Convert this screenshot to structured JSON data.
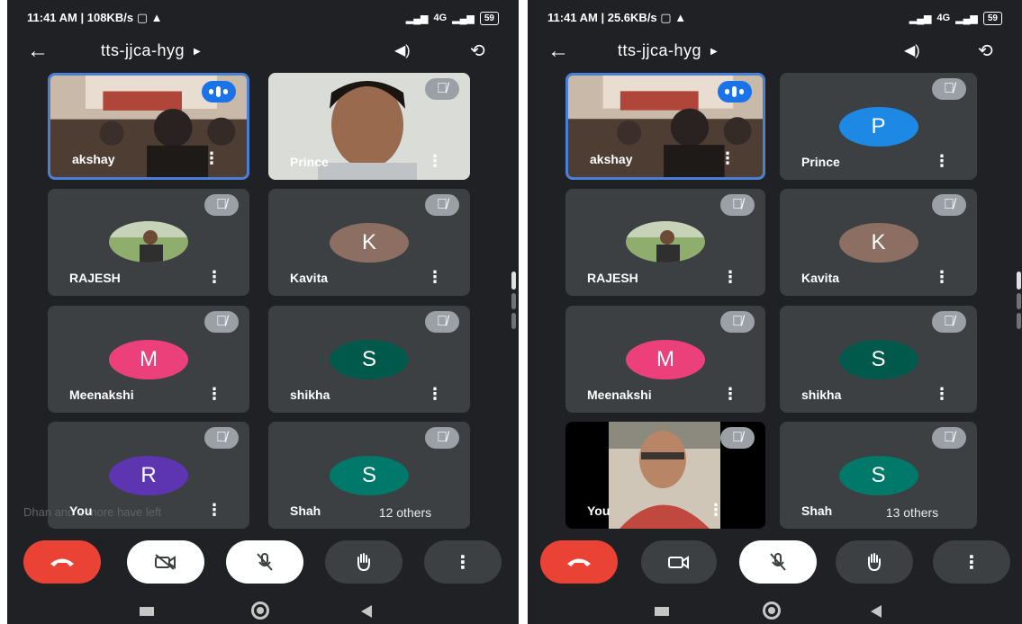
{
  "left": {
    "status": {
      "time": "11:41 AM | 108KB/s",
      "network": "4G",
      "battery": "59"
    },
    "meeting_title": "tts-jjca-hyg",
    "tiles": [
      {
        "name": "akshay",
        "initial": "",
        "color": "",
        "speaking": true
      },
      {
        "name": "Prince",
        "initial": "",
        "color": ""
      },
      {
        "name": "RAJESH",
        "initial": "",
        "color": ""
      },
      {
        "name": "Kavita",
        "initial": "K",
        "color": "#8d6e63"
      },
      {
        "name": "Meenakshi",
        "initial": "M",
        "color": "#ec407a"
      },
      {
        "name": "shikha",
        "initial": "S",
        "color": "#00594a"
      },
      {
        "name": "You",
        "initial": "R",
        "color": "#5e35b1"
      },
      {
        "name": "Shah",
        "initial": "S",
        "color": "#00796b"
      }
    ],
    "others_label": "12 others",
    "toast": "Dhan   and 2 more have left"
  },
  "right": {
    "status": {
      "time": "11:41 AM | 25.6KB/s",
      "network": "4G",
      "battery": "59"
    },
    "meeting_title": "tts-jjca-hyg",
    "tiles": [
      {
        "name": "akshay",
        "initial": "",
        "color": "",
        "speaking": true
      },
      {
        "name": "Prince",
        "initial": "P",
        "color": "#1e88e5"
      },
      {
        "name": "RAJESH",
        "initial": "",
        "color": ""
      },
      {
        "name": "Kavita",
        "initial": "K",
        "color": "#8d6e63"
      },
      {
        "name": "Meenakshi",
        "initial": "M",
        "color": "#ec407a"
      },
      {
        "name": "shikha",
        "initial": "S",
        "color": "#00594a"
      },
      {
        "name": "You",
        "initial": "",
        "color": ""
      },
      {
        "name": "Shah",
        "initial": "S",
        "color": "#00796b"
      }
    ],
    "others_label": "13 others"
  },
  "colors": {
    "end_call": "#ea4335",
    "surface": "#3c4043",
    "background": "#202124",
    "speaking": "#1a73e8"
  }
}
